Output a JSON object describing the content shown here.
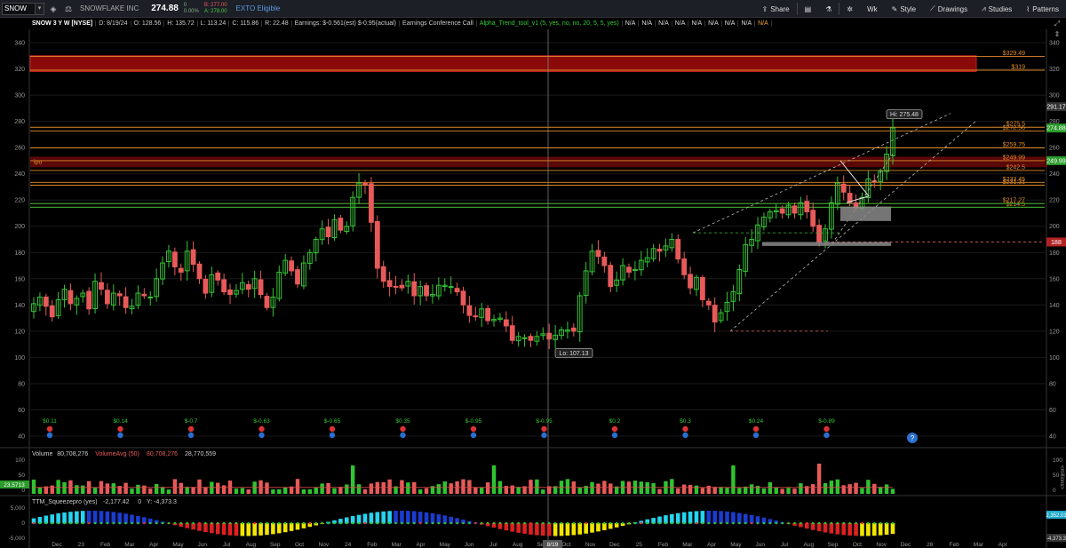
{
  "toolbar": {
    "symbol": "SNOW",
    "company": "SNOWFLAKE INC",
    "last": "274.88",
    "change": "0",
    "change_pct": "0.00%",
    "bid": "B: 277.00",
    "ask": "A: 278.00",
    "expo": "EXTO Eligible",
    "share": "Share",
    "period": "Wk",
    "style": "Style",
    "drawings": "Drawings",
    "studies": "Studies",
    "patterns": "Patterns"
  },
  "info": {
    "title": "SNOW 3 Y W [NYSE]",
    "date": "D: 8/19/24",
    "open": "O: 128.56",
    "high": "H: 135.72",
    "low": "L: 113.24",
    "close": "C: 115.86",
    "range": "R: 22.48",
    "earnings": "Earnings: $-0.561(est) $-0.95(actual)",
    "call": "Earnings Conference Call",
    "study": "Alpha_Trend_tool_v1 (5, yes, no, no, 20, 5, 5, yes)",
    "na": [
      "N/A",
      "N/A",
      "N/A",
      "N/A",
      "N/A",
      "N/A",
      "N/A",
      "N/A",
      "N/A"
    ]
  },
  "chart_data": {
    "type": "candlestick",
    "symbol": "SNOW",
    "period": "Weekly, 3 years",
    "y_ticks": [
      40,
      60,
      80,
      100,
      120,
      140,
      160,
      180,
      200,
      220,
      240,
      260,
      280,
      300,
      320,
      340
    ],
    "x_ticks": [
      "Dec",
      "23",
      "Feb",
      "Mar",
      "Apr",
      "May",
      "Jun",
      "Jul",
      "Aug",
      "Sep",
      "Oct",
      "Nov",
      "24",
      "Feb",
      "Mar",
      "Apr",
      "May",
      "Jun",
      "Jul",
      "Aug",
      "Sep",
      "Oct",
      "Nov",
      "Dec",
      "25",
      "Feb",
      "Mar",
      "Apr",
      "May",
      "Jun",
      "Jul",
      "Aug",
      "Sep",
      "Oct",
      "Nov",
      "Dec",
      "26",
      "Feb",
      "Mar",
      "Apr"
    ],
    "x_cursor_label": "8/19",
    "closes": [
      141,
      146,
      139,
      131,
      144,
      152,
      141,
      145,
      149,
      137,
      158,
      152,
      141,
      149,
      147,
      138,
      139,
      149,
      147,
      146,
      160,
      172,
      181,
      169,
      165,
      181,
      171,
      160,
      149,
      163,
      159,
      150,
      148,
      151,
      157,
      152,
      160,
      148,
      138,
      146,
      165,
      174,
      166,
      156,
      172,
      180,
      190,
      198,
      192,
      205,
      197,
      200,
      222,
      233,
      232,
      203,
      168,
      158,
      154,
      154,
      153,
      158,
      147,
      154,
      147,
      148,
      155,
      155,
      154,
      150,
      140,
      132,
      131,
      137,
      128,
      129,
      130,
      124,
      113,
      116,
      115,
      113,
      116,
      118,
      114,
      117,
      121,
      121,
      120,
      147,
      166,
      181,
      177,
      170,
      154,
      159,
      170,
      165,
      167,
      174,
      176,
      183,
      181,
      185,
      190,
      175,
      163,
      153,
      161,
      144,
      140,
      127,
      134,
      142,
      150,
      167,
      186,
      190,
      201,
      207,
      211,
      212,
      210,
      216,
      210,
      218,
      211,
      200,
      188,
      198,
      218,
      233,
      226,
      218,
      214,
      222,
      236,
      234,
      242,
      255,
      275
    ],
    "opens_note": "derived",
    "hi": "Hi: 275.48",
    "lo": "Lo: 107.13",
    "price_levels": [
      {
        "value": 329.49,
        "label": "$329.49",
        "color": "#e08a2a"
      },
      {
        "value": 319,
        "label": "$319",
        "color": "#e08a2a"
      },
      {
        "value": 275.5,
        "label": "$275.5",
        "color": "#e08a2a"
      },
      {
        "value": 272.56,
        "label": "$272.56",
        "color": "#e08a2a"
      },
      {
        "value": 259.75,
        "label": "$259.75",
        "color": "#e08a2a"
      },
      {
        "value": 249.99,
        "label": "$249.99",
        "color": "#e08a2a"
      },
      {
        "value": 242.5,
        "label": "$242.5",
        "color": "#e08a2a"
      },
      {
        "value": 233.45,
        "label": "$233.45",
        "color": "#e08a2a"
      },
      {
        "value": 231.31,
        "label": "$231.31",
        "color": "#e08a2a"
      },
      {
        "value": 217.27,
        "label": "$217.27",
        "color": "#e08a2a"
      },
      {
        "value": 214.5,
        "label": "$214.5",
        "color": "#e08a2a"
      }
    ],
    "ipo_label": "ipo",
    "right_labels": [
      {
        "value": 291.17,
        "label": "291.17",
        "kind": "plain"
      },
      {
        "value": 274.88,
        "label": "274.88",
        "kind": "green"
      },
      {
        "value": 249.99,
        "label": "249.99",
        "kind": "green"
      },
      {
        "value": 188,
        "label": "188",
        "kind": "red"
      }
    ],
    "earnings": [
      {
        "label": "$0.11",
        "color": "#3c3"
      },
      {
        "label": "$0.14",
        "color": "#3c3"
      },
      {
        "label": "$-0.7",
        "color": "#3c3"
      },
      {
        "label": "$-0.63",
        "color": "#3c3"
      },
      {
        "label": "$-0.65",
        "color": "#3c3"
      },
      {
        "label": "$0.35",
        "color": "#3c3"
      },
      {
        "label": "$-0.95",
        "color": "#3c3"
      },
      {
        "label": "$-0.95",
        "color": "#3c3"
      },
      {
        "label": "$0.2",
        "color": "#3c3"
      },
      {
        "label": "$0.3",
        "color": "#3c3"
      },
      {
        "label": "$0.24",
        "color": "#3c3"
      },
      {
        "label": "$-0.89",
        "color": "#3c3"
      }
    ],
    "volume_header": [
      "Volume",
      "80,708,276",
      "VolumeAvg (50)",
      "80,708,276",
      "28,770,559"
    ],
    "volume_ticks": [
      "100",
      "50",
      "0"
    ],
    "volume_left": "23.5713",
    "volume_unit": "<millions>",
    "ttm_header": [
      "TTM_Squeezepro (yes)",
      "-2,177.42",
      "0",
      "Y: -4,373.3"
    ],
    "ttm_ticks": [
      "5,000",
      "0",
      "-5,000"
    ],
    "ttm_right": [
      "2,352.01",
      "-4,373.3"
    ]
  }
}
